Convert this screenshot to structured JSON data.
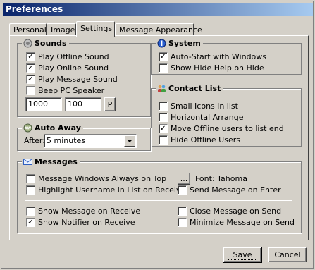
{
  "window": {
    "title": "Preferences"
  },
  "tabs": [
    {
      "label": "Personal",
      "active": false
    },
    {
      "label": "Image",
      "active": false
    },
    {
      "label": "Settings",
      "active": true
    },
    {
      "label": "Message Appearance",
      "active": false
    }
  ],
  "sounds": {
    "title": "Sounds",
    "icon": "speaker-icon",
    "options": [
      {
        "label": "Play Offline Sound",
        "checked": true
      },
      {
        "label": "Play Online Sound",
        "checked": true
      },
      {
        "label": "Play Message Sound",
        "checked": true
      },
      {
        "label": "Beep PC Speaker",
        "checked": false
      }
    ],
    "frequency": "1000",
    "duration": "100",
    "play_label": "P"
  },
  "system": {
    "title": "System",
    "icon": "info-icon",
    "options": [
      {
        "label": "Auto-Start with Windows",
        "checked": true
      },
      {
        "label": "Show Hide Help on Hide",
        "checked": false
      }
    ]
  },
  "contact_list": {
    "title": "Contact List",
    "icon": "contacts-icon",
    "options": [
      {
        "label": "Small Icons in list",
        "checked": false
      },
      {
        "label": "Horizontal Arrange",
        "checked": false
      },
      {
        "label": "Move Offline users to list end",
        "checked": true
      },
      {
        "label": "Hide Offline Users",
        "checked": false
      }
    ]
  },
  "auto_away": {
    "title": "Auto Away",
    "icon": "away-icon",
    "after_label": "After:",
    "selected": "5 minutes"
  },
  "messages": {
    "title": "Messages",
    "icon": "envelope-icon",
    "left_options": [
      {
        "label": "Message Windows Always on Top",
        "checked": false
      },
      {
        "label": "Highlight Username in List on Receive",
        "checked": false
      },
      {
        "label": "Show Message on Receive",
        "checked": false
      },
      {
        "label": "Show Notifier on Receive",
        "checked": true
      }
    ],
    "right_options": [
      {
        "label": "Send Message on Enter",
        "checked": false
      },
      {
        "label": "Close Message on Send",
        "checked": false
      },
      {
        "label": "Minimize Message on Send",
        "checked": false
      }
    ],
    "font_button_label": "...",
    "font_label": "Font: Tahoma"
  },
  "footer": {
    "save_label": "Save",
    "cancel_label": "Cancel"
  },
  "colors": {
    "face": "#d4d0c8",
    "title_start": "#0a246a",
    "title_end": "#a6caf0"
  }
}
